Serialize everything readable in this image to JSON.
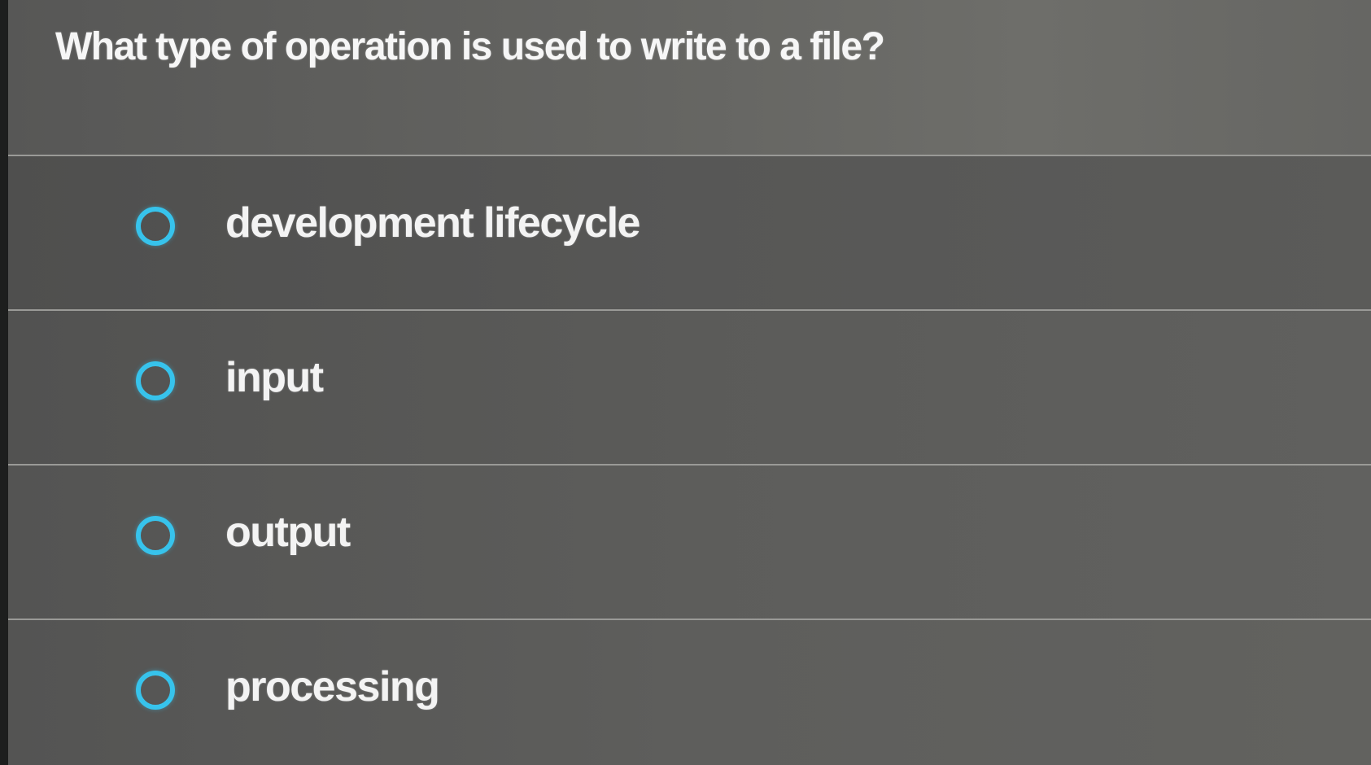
{
  "question": {
    "text": "What type of operation is used to write to a file?"
  },
  "options": [
    {
      "label": "development lifecycle",
      "selected": false
    },
    {
      "label": "input",
      "selected": false
    },
    {
      "label": "output",
      "selected": false
    },
    {
      "label": "processing",
      "selected": false
    }
  ],
  "colors": {
    "radio_ring": "#37c3ec",
    "text": "#f3f3f3",
    "divider": "#9a9a97"
  }
}
